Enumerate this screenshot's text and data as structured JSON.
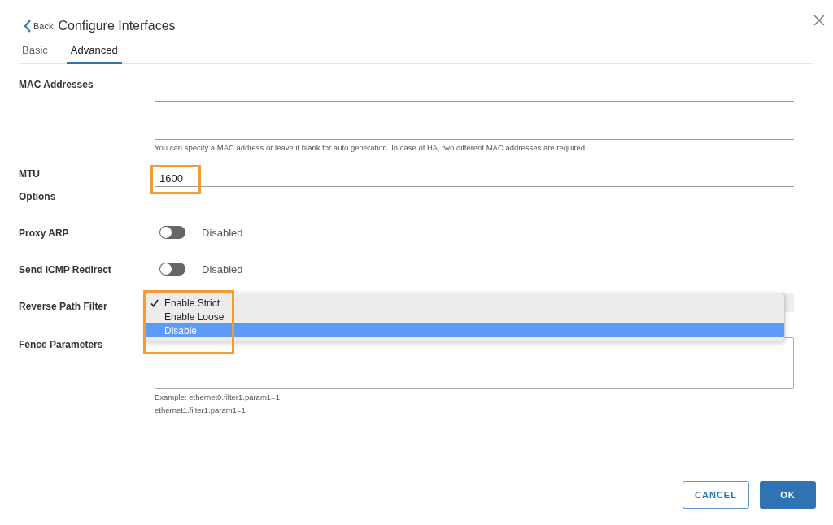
{
  "header": {
    "back": "Back",
    "title": "Configure Interfaces"
  },
  "tabs": [
    {
      "label": "Basic",
      "selected": false
    },
    {
      "label": "Advanced",
      "selected": true
    }
  ],
  "mac_addresses": {
    "label": "MAC Addresses",
    "help": "You can specify a MAC address or leave it blank for auto generation. In case of HA, two different MAC addresses are required."
  },
  "mtu": {
    "label": "MTU",
    "value": "1600",
    "highlighted": true
  },
  "options_heading": "Options",
  "toggles": [
    {
      "label": "Proxy ARP",
      "on": false,
      "state_text": "Disabled"
    },
    {
      "label": "Send ICMP Redirect",
      "on": false,
      "state_text": "Disabled"
    }
  ],
  "reverse_path_filter": {
    "label": "Reverse Path Filter",
    "menu_highlighted": true,
    "options": [
      {
        "label": "Enable Strict",
        "checked": true,
        "selected": false
      },
      {
        "label": "Enable Loose",
        "checked": false,
        "selected": false
      },
      {
        "label": "Disable",
        "checked": false,
        "selected": true
      }
    ]
  },
  "fence_parameters": {
    "label": "Fence Parameters",
    "help_lines": [
      "Example: ethernet0.filter1.param1=1",
      "ethernet1.filter1.param1=1"
    ]
  },
  "buttons": {
    "cancel": "CANCEL",
    "ok": "OK"
  }
}
